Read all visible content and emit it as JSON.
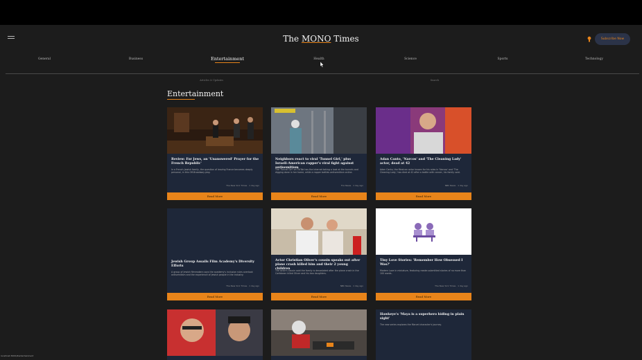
{
  "header": {
    "brand_prefix": "The ",
    "brand_mono": "MONO",
    "brand_suffix": " Times",
    "subscribe_label": "Subscribe Now",
    "icons": {
      "menu": "menu-icon",
      "theme": "lightbulb-icon"
    }
  },
  "nav": {
    "items": [
      {
        "label": "General"
      },
      {
        "label": "Business"
      },
      {
        "label": "Entertainment"
      },
      {
        "label": "Health"
      },
      {
        "label": "Science"
      },
      {
        "label": "Sports"
      },
      {
        "label": "Technology"
      }
    ],
    "active": "Entertainment"
  },
  "subnav": {
    "left": "Articles & Updates",
    "right": "Search"
  },
  "section": {
    "title": "Entertainment"
  },
  "colors": {
    "accent": "#e8841a",
    "card": "#1e2739",
    "background": "#1c1c1c"
  },
  "cards": [
    {
      "title": "Review: For Jews, an 'Unanswered' Prayer for the French Republic'",
      "desc": "In a French-Jewish family, the question of leaving France becomes deeply personal, in this Off-Broadway play.",
      "source": "The New York Times · 1 day ago",
      "button": "Read More"
    },
    {
      "title": "Neighbors react to viral 'Tunnel Girl,' plus Israeli-American rapper's viral fight against antisemitism",
      "desc": "The 'Tunnel Girl' on TikTok has the internet taking a look at the tunnels and digging done in her home, while a rapper battles antisemitism online.",
      "source": "Fox News · 1 day ago",
      "button": "Read More"
    },
    {
      "title": "Adan Canto, 'Narcos' and 'The Cleaning Lady' actor, dead at 42",
      "desc": "Adan Canto, the Mexican actor known for his roles in 'Narcos' and 'The Cleaning Lady,' has died at 42 after a battle with cancer, his family said.",
      "source": "NBC News · 1 day ago",
      "button": "Read More"
    },
    {
      "title": "Jewish Group Assails Film Academy's Diversity Efforts",
      "desc": "A group of Jewish filmmakers says the academy's inclusion rules overlook antisemitism and the experience of Jewish people in the industry.",
      "source": "The New York Times · 1 day ago",
      "button": "Read More"
    },
    {
      "title": "Actor Christian Oliver's cousin speaks out after plane crash killed him and their 2 young children",
      "desc": "The actor's cousin said the family is devastated after the plane crash in the Caribbean killed Oliver and his two daughters.",
      "source": "NBC News · 1 day ago",
      "button": "Read More"
    },
    {
      "title": "Tiny Love Stories: 'Remember How Obsessed I Was?'",
      "desc": "Modern Love in miniature, featuring reader-submitted stories of no more than 100 words.",
      "source": "The New York Times · 1 day ago",
      "button": "Read More"
    },
    {
      "title": "",
      "desc": "",
      "source": "",
      "button": ""
    },
    {
      "title": "",
      "desc": "",
      "source": "",
      "button": ""
    },
    {
      "title": "Hawkeye's 'Maya is a superhero hiding in plain sight'",
      "desc": "The new series explores the Marvel character's journey.",
      "source": "",
      "button": ""
    }
  ],
  "status": {
    "text": "localhost:3000/#entertainment"
  }
}
